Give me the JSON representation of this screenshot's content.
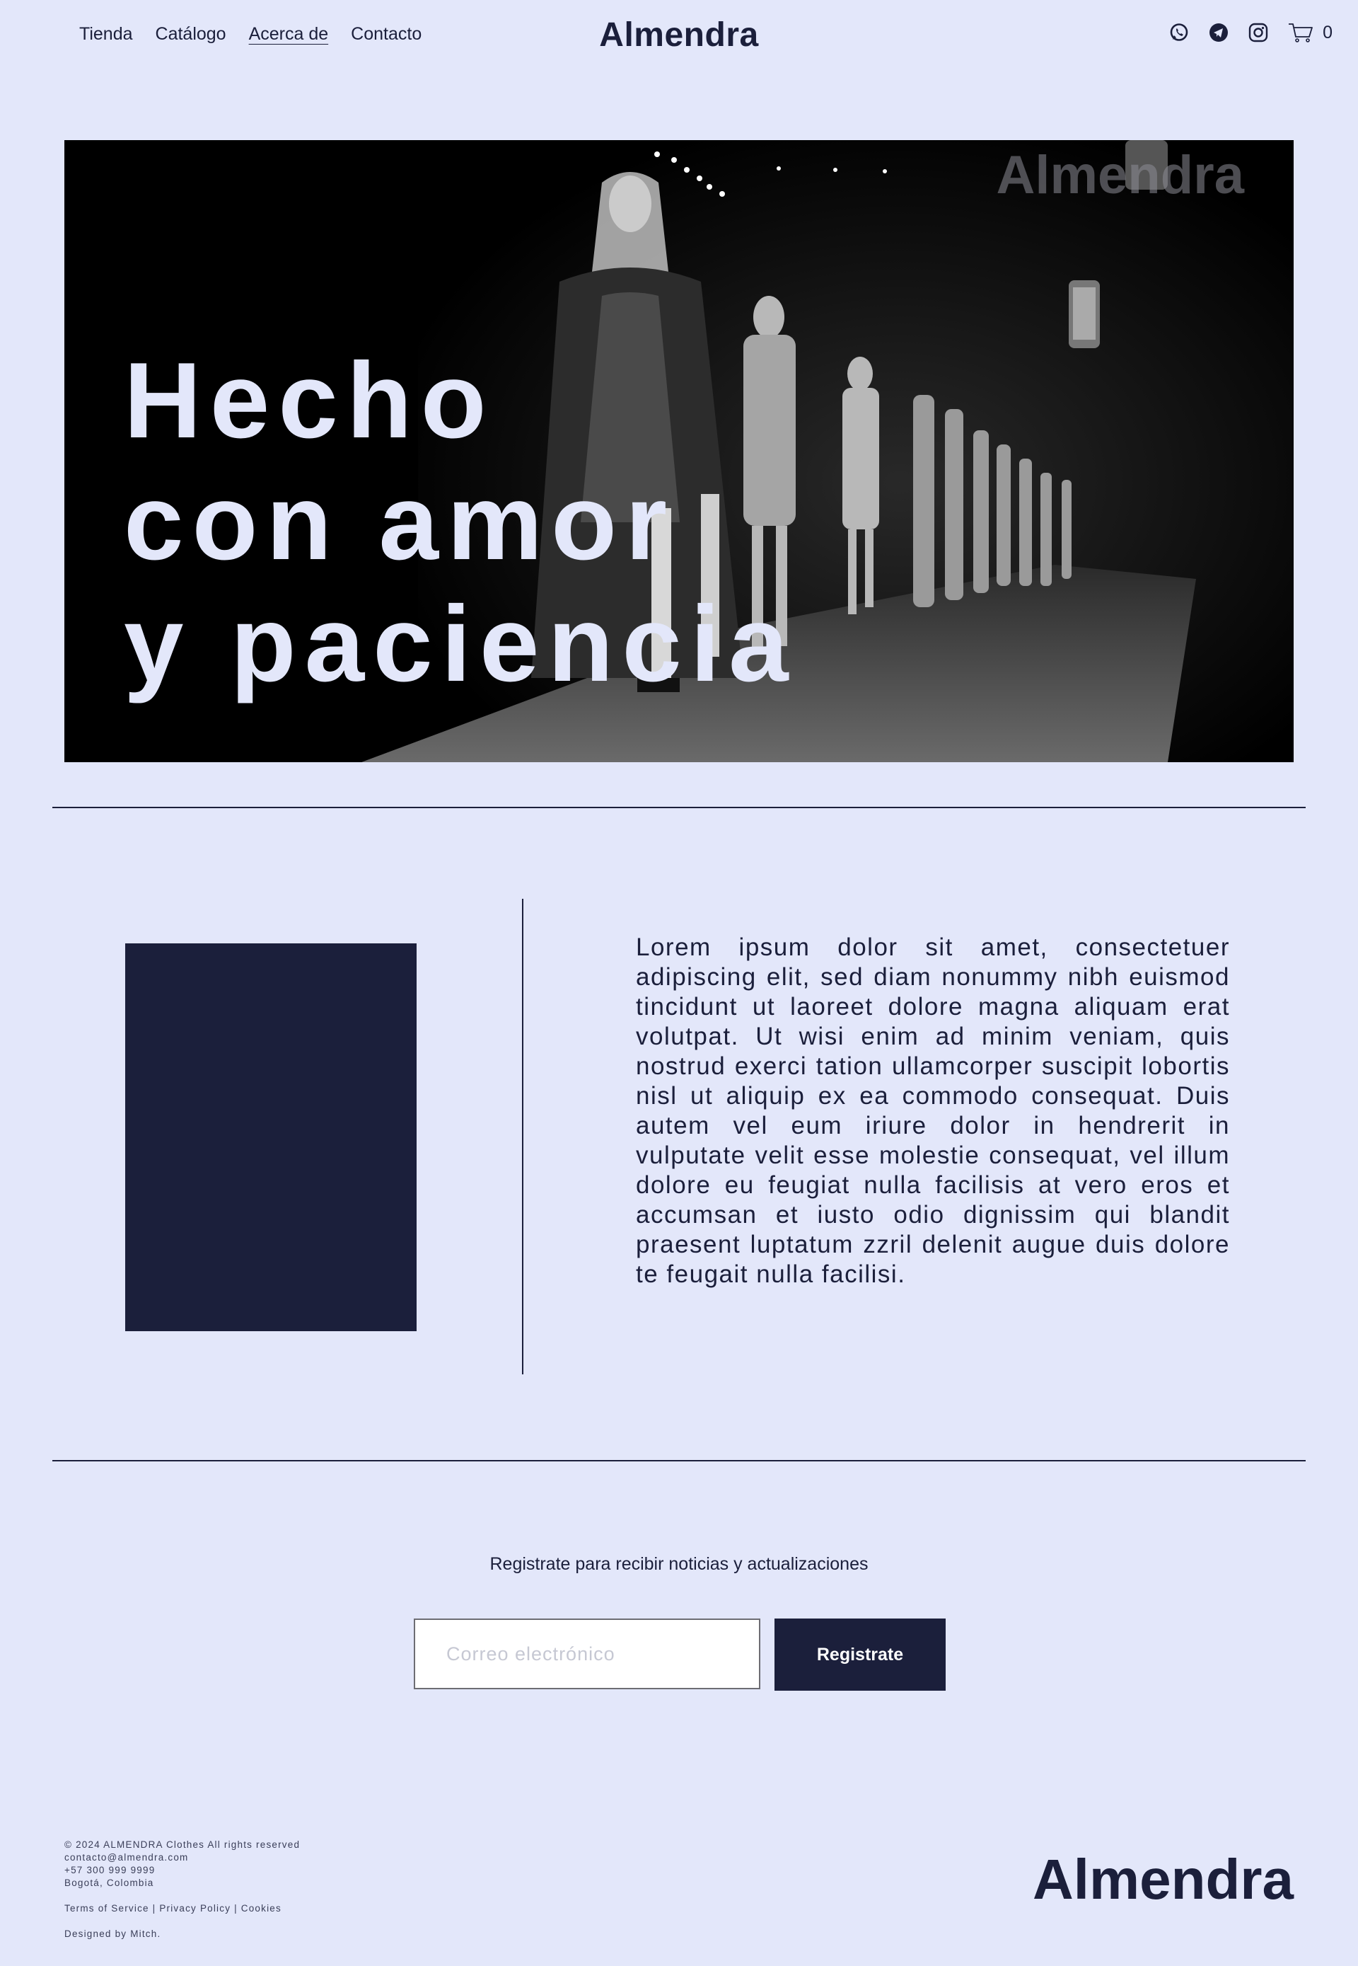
{
  "header": {
    "nav": [
      {
        "label": "Tienda"
      },
      {
        "label": "Catálogo"
      },
      {
        "label": "Acerca de",
        "active": true
      },
      {
        "label": "Contacto"
      }
    ],
    "brand": "Almendra",
    "icons": [
      "whatsapp-icon",
      "telegram-icon",
      "instagram-icon",
      "cart-icon"
    ],
    "cart_count": "0"
  },
  "hero": {
    "watermark": "Almendra",
    "title_lines": [
      "Hecho",
      "con amor",
      "y paciencia"
    ],
    "image_description_icon": "runway-photo"
  },
  "about": {
    "text": "Lorem ipsum dolor sit amet, consectetuer adipiscing elit, sed diam nonummy nibh euismod tincidunt ut laoreet dolore magna aliquam erat volutpat. Ut wisi enim ad minim veniam, quis nostrud exerci tation ullamcorper suscipit lobortis nisl ut aliquip ex ea commodo consequat. Duis autem vel eum iriure dolor in hendrerit in vulputate velit esse molestie consequat, vel illum dolore eu feugiat nulla facilisis at vero eros et accumsan et iusto odio dignissim qui blandit praesent luptatum zzril delenit augue duis dolore te feugait nulla facilisi."
  },
  "signup": {
    "text": "Registrate para recibir noticias y actualizaciones",
    "placeholder": "Correo electrónico",
    "value": "",
    "button": "Registrate"
  },
  "footer": {
    "copyright": "© 2024 ALMENDRA Clothes All rights reserved",
    "email": "contacto@almendra.com",
    "phone": "+57 300 999 9999",
    "location": "Bogotá, Colombia",
    "legal": "Terms of Service | Privacy Policy | Cookies",
    "credit": "Designed by Mitch.",
    "brand": "Almendra"
  },
  "colors": {
    "background": "#e3e7fa",
    "ink": "#1b1f3b"
  }
}
